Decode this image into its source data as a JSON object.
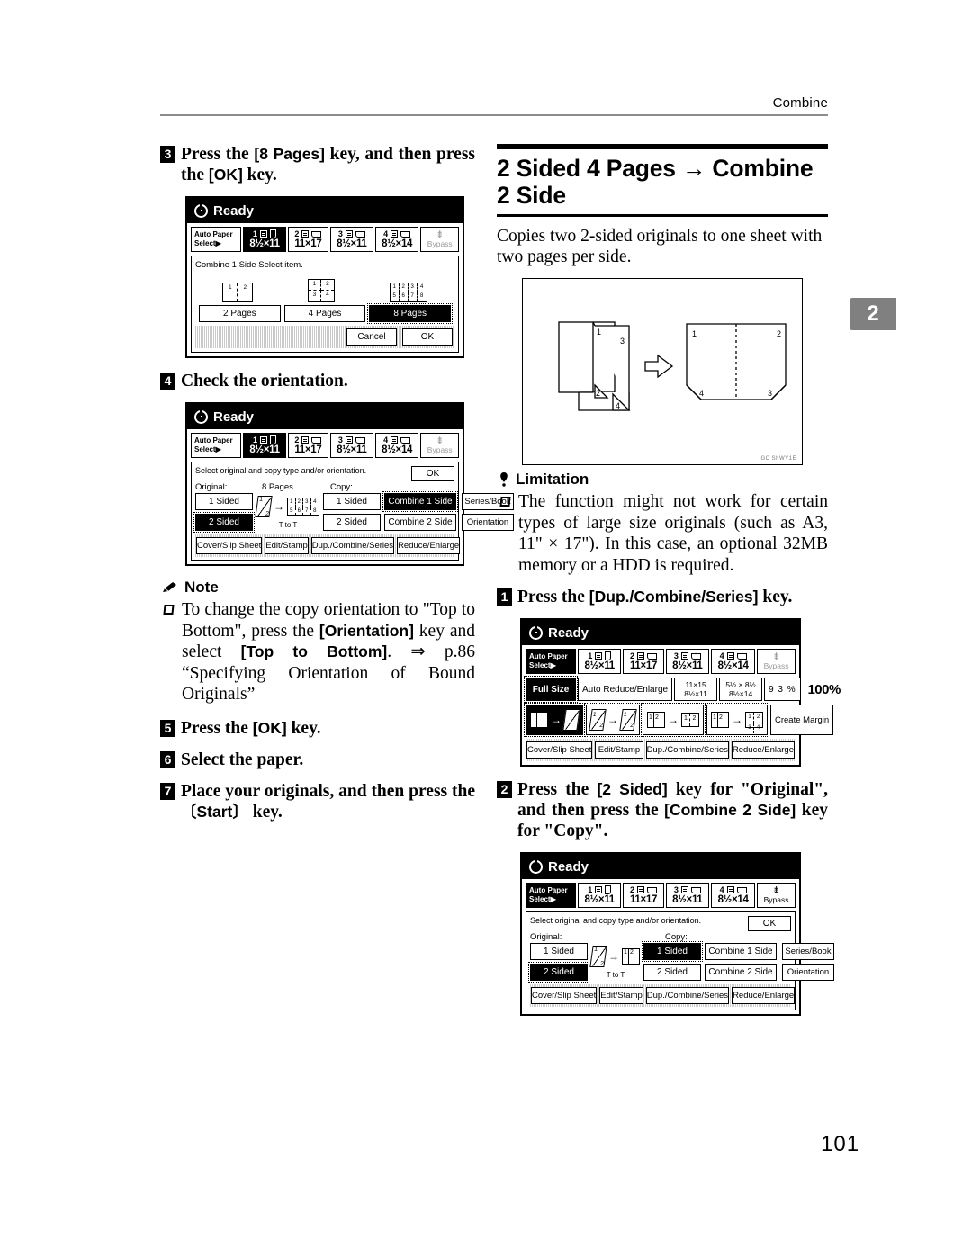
{
  "header": {
    "chapter_label": "Combine"
  },
  "chapter_tab": {
    "number": "2"
  },
  "page_number": "101",
  "left_column": {
    "step3": {
      "num": "3",
      "text_a": "Press the ",
      "key_a": "[8 Pages]",
      "text_b": " key, and then press the ",
      "key_b": "[OK]",
      "text_c": " key."
    },
    "step4": {
      "num": "4",
      "text": "Check the orientation."
    },
    "note": {
      "title": "Note",
      "items": [
        {
          "t1": "To change the copy orientation to \"Top to Bottom\", press the ",
          "k1": "[Orientation]",
          "t2": " key and select ",
          "k2": "[Top to Bottom]",
          "t3": ". ⇒ p.86 “Specifying Orientation of Bound Originals”"
        }
      ]
    },
    "step5": {
      "num": "5",
      "text_a": "Press the ",
      "key_a": "[OK]",
      "text_b": " key."
    },
    "step6": {
      "num": "6",
      "text": "Select the paper."
    },
    "step7": {
      "num": "7",
      "text_a": "Place your originals, and then press the ",
      "key_a": "〔Start〕",
      "text_b": " key."
    }
  },
  "right_column": {
    "section_title": "2 Sided 4 Pages → Combine 2 Side",
    "intro": "Copies two 2-sided originals to one sheet with two pages per side.",
    "figure": {
      "code": "GC ShWY1E",
      "original_labels": [
        "1",
        "3",
        "2",
        "4"
      ],
      "result_labels": [
        "1",
        "2",
        "4",
        "3"
      ]
    },
    "limitation": {
      "title": "Limitation",
      "items": [
        "The function might not work for certain types of large size originals (such as A3, 11\" × 17\"). In this case, an optional 32MB memory or a HDD is required."
      ]
    },
    "step1": {
      "num": "1",
      "text_a": "Press the ",
      "key_a": "[Dup./Combine/Series]",
      "text_b": " key."
    },
    "step2": {
      "num": "2",
      "text_a": "Press the ",
      "key_a": "[2 Sided]",
      "text_b": " key for \"Original\", and then press the ",
      "key_b": "[Combine 2 Side]",
      "text_c": " key for \"Copy\"."
    }
  },
  "lcd_common": {
    "status": "Ready",
    "auto_paper_line1": "Auto Paper",
    "auto_paper_line2": "Select▶",
    "trays": [
      {
        "id": "1",
        "size": "8½×11"
      },
      {
        "id": "2",
        "size": "11×17"
      },
      {
        "id": "3",
        "size": "8½×11"
      },
      {
        "id": "4",
        "size": "8½×14"
      }
    ],
    "bypass_label": "Bypass"
  },
  "lcd_panel_1": {
    "selected_tray": "1",
    "area_title": "Combine 1 Side   Select item.",
    "thumb_2pages": [
      "1",
      "2"
    ],
    "thumb_4pages": [
      "1",
      "2",
      "3",
      "4"
    ],
    "thumb_8pages": [
      "1",
      "2",
      "3",
      "4",
      "5",
      "6",
      "7",
      "8"
    ],
    "keys": [
      {
        "label": "2 Pages",
        "selected": false
      },
      {
        "label": "4 Pages",
        "selected": false
      },
      {
        "label": "8 Pages",
        "selected": true
      }
    ],
    "cancel_label": "Cancel",
    "ok_label": "OK"
  },
  "lcd_panel_2": {
    "selected_tray": "1",
    "hint": "Select original and copy type and/or orientation.",
    "ok_label": "OK",
    "original_label": "Original:",
    "copy_label": "Copy:",
    "pages_label": "8 Pages",
    "orientation_label": "T to T",
    "thumb_result": [
      "1",
      "2",
      "3",
      "4",
      "5",
      "6",
      "7",
      "8"
    ],
    "original_keys": [
      {
        "label": "1 Sided",
        "selected": false
      },
      {
        "label": "2 Sided",
        "selected": true
      }
    ],
    "copy_keys_col1": [
      {
        "label": "1 Sided",
        "selected": false
      },
      {
        "label": "2 Sided",
        "selected": false
      }
    ],
    "copy_keys_col2": [
      {
        "label": "Combine 1 Side",
        "selected": true
      },
      {
        "label": "Combine 2 Side",
        "selected": false
      }
    ],
    "side_keys": [
      {
        "label": "Series/Book",
        "selected": false
      },
      {
        "label": "Orientation",
        "selected": false
      }
    ],
    "bottom_keys": [
      "Cover/Slip Sheet",
      "Edit/Stamp",
      "Dup./Combine/Series",
      "Reduce/Enlarge"
    ]
  },
  "lcd_panel_3": {
    "selected_tray": "none",
    "auto_paper_selected": true,
    "ratio_keys": [
      {
        "label": "Full Size",
        "selected": true
      },
      {
        "label": "Auto Reduce/Enlarge",
        "selected": false
      },
      {
        "line1": "11×15",
        "line2": "8½×11",
        "selected": false
      },
      {
        "line1": "5½ × 8½",
        "line2": "8½×14",
        "selected": false
      },
      {
        "label": "9 3 %",
        "selected": false
      }
    ],
    "zoom_value": "100%",
    "dup_keys": [
      {
        "kind": "1to2",
        "selected": true
      },
      {
        "kind": "2to2",
        "selected": false
      },
      {
        "kind": "2to1combine",
        "selected": false
      },
      {
        "kind": "2to4combine",
        "selected": false
      },
      {
        "label": "Create Margin",
        "selected": false
      }
    ],
    "bottom_keys": [
      "Cover/Slip Sheet",
      "Edit/Stamp",
      "Dup./Combine/Series",
      "Reduce/Enlarge"
    ]
  },
  "lcd_panel_4": {
    "selected_tray": "none",
    "auto_paper_selected": true,
    "hint": "Select original and copy type and/or orientation.",
    "ok_label": "OK",
    "original_label": "Original:",
    "copy_label": "Copy:",
    "orientation_label": "T to T",
    "original_keys": [
      {
        "label": "1 Sided",
        "selected": false
      },
      {
        "label": "2 Sided",
        "selected": true
      }
    ],
    "copy_keys_col1": [
      {
        "label": "1 Sided",
        "selected": true
      },
      {
        "label": "2 Sided",
        "selected": false
      }
    ],
    "copy_keys_col2": [
      {
        "label": "Combine 1 Side",
        "selected": false
      },
      {
        "label": "Combine 2 Side",
        "selected": false
      }
    ],
    "side_keys": [
      {
        "label": "Series/Book",
        "selected": false
      },
      {
        "label": "Orientation",
        "selected": false
      }
    ],
    "bottom_keys": [
      "Cover/Slip Sheet",
      "Edit/Stamp",
      "Dup./Combine/Series",
      "Reduce/Enlarge"
    ]
  }
}
